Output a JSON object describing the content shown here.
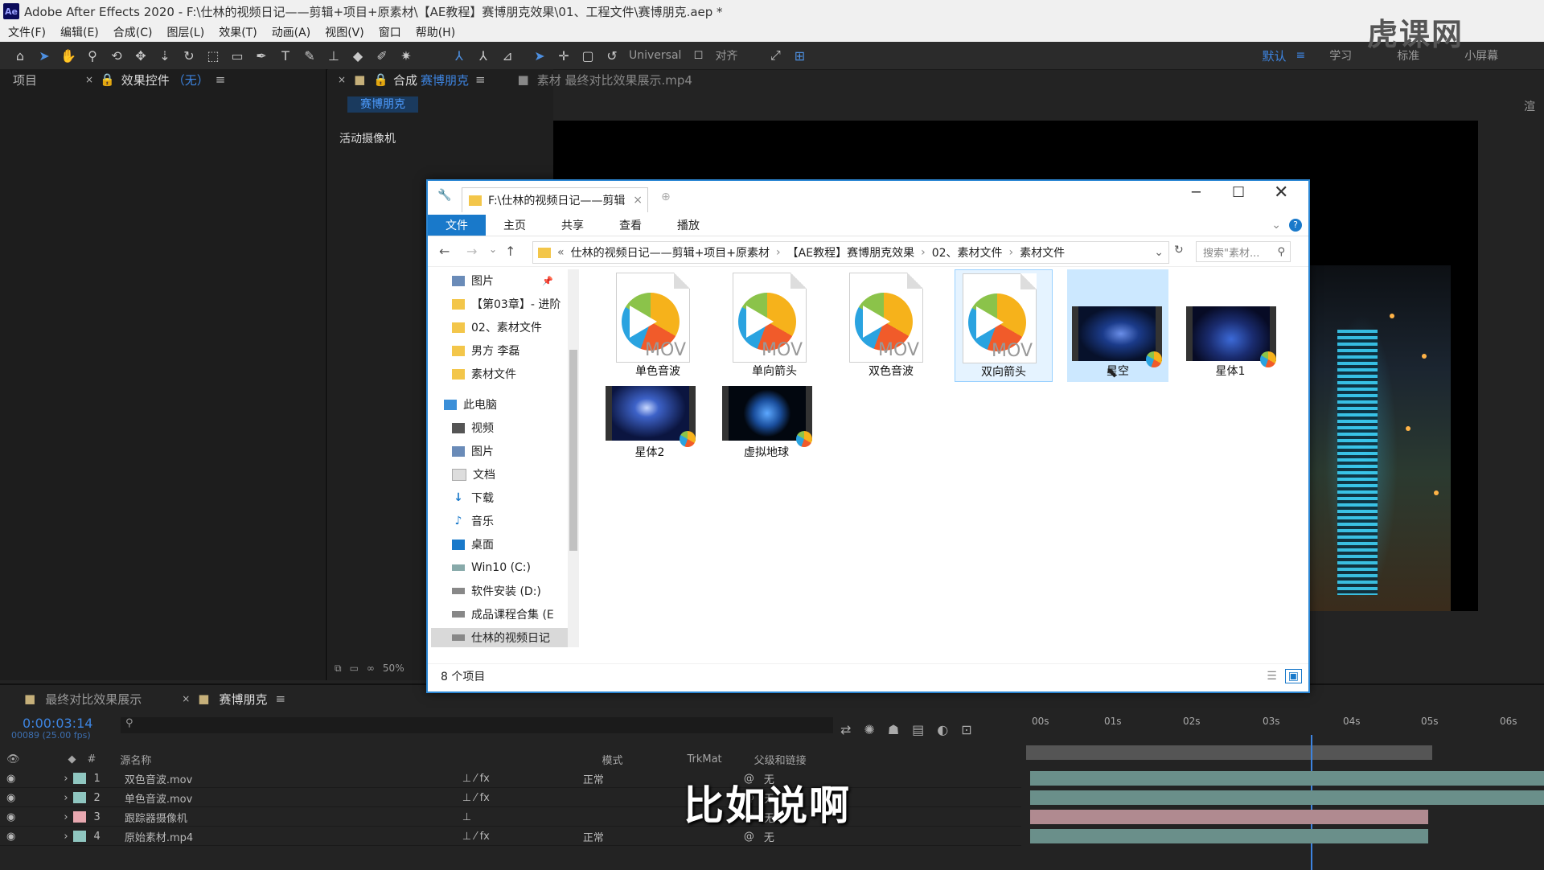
{
  "titlebar": {
    "app_icon": "Ae",
    "title": "Adobe After Effects 2020 - F:\\仕林的视频日记——剪辑+项目+原素材\\【AE教程】赛博朋克效果\\01、工程文件\\赛博朋克.aep *"
  },
  "menubar": [
    "文件(F)",
    "编辑(E)",
    "合成(C)",
    "图层(L)",
    "效果(T)",
    "动画(A)",
    "视图(V)",
    "窗口",
    "帮助(H)"
  ],
  "toolbar": {
    "axis_mode": "Universal",
    "snap_label": "对齐",
    "workspace": "默认",
    "workspace2": "学习",
    "workspace3": "标准",
    "workspace4": "小屏幕"
  },
  "watermark": "虎课网",
  "left_panel": {
    "tab_project": "项目",
    "tab_effects": "效果控件",
    "effects_target": "（无）"
  },
  "comp_panel": {
    "tab_comp": "合成",
    "comp_name": "赛博朋克",
    "tab_footage": "素材 最终对比效果展示.mp4",
    "active_comp_button": "赛博朋克",
    "camera_label": "活动摄像机",
    "zoom": "50%",
    "render_label": "渲"
  },
  "explorer": {
    "tab_path": "F:\\仕林的视频日记——剪辑",
    "ribbon": [
      "文件",
      "主页",
      "共享",
      "查看",
      "播放"
    ],
    "breadcrumb": [
      "仕林的视频日记——剪辑+项目+原素材",
      "【AE教程】赛博朋克效果",
      "02、素材文件",
      "素材文件"
    ],
    "search_placeholder": "搜索\"素材...",
    "nav": [
      {
        "label": "图片",
        "type": "pic"
      },
      {
        "label": "【第03章】- 进阶",
        "type": "folder"
      },
      {
        "label": "02、素材文件",
        "type": "folder"
      },
      {
        "label": "男方 李磊",
        "type": "folder"
      },
      {
        "label": "素材文件",
        "type": "folder"
      },
      {
        "label": "此电脑",
        "type": "pc"
      },
      {
        "label": "视频",
        "type": "video"
      },
      {
        "label": "图片",
        "type": "pic"
      },
      {
        "label": "文档",
        "type": "doc"
      },
      {
        "label": "下载",
        "type": "download"
      },
      {
        "label": "音乐",
        "type": "music"
      },
      {
        "label": "桌面",
        "type": "desktop"
      },
      {
        "label": "Win10 (C:)",
        "type": "drive"
      },
      {
        "label": "软件安装 (D:)",
        "type": "drive"
      },
      {
        "label": "成品课程合集 (E",
        "type": "drive"
      },
      {
        "label": "仕林的视频日记",
        "type": "drive"
      }
    ],
    "files": [
      {
        "name": "单色音波",
        "kind": "mov",
        "ext": "MOV"
      },
      {
        "name": "单向箭头",
        "kind": "mov",
        "ext": "MOV"
      },
      {
        "name": "双色音波",
        "kind": "mov",
        "ext": "MOV"
      },
      {
        "name": "双向箭头",
        "kind": "mov",
        "ext": "MOV"
      },
      {
        "name": "星空",
        "kind": "video"
      },
      {
        "name": "星体1",
        "kind": "video"
      },
      {
        "name": "星体2",
        "kind": "video"
      },
      {
        "name": "虚拟地球",
        "kind": "video"
      }
    ],
    "status": "8 个项目"
  },
  "timeline": {
    "tab1": "最终对比效果展示",
    "tab2": "赛博朋克",
    "timecode": "0:00:03:14",
    "frame_info": "00089 (25.00 fps)",
    "col_source": "源名称",
    "col_mode": "模式",
    "col_trkmat": "TrkMat",
    "col_parent": "父级和链接",
    "ruler": [
      "00s",
      "01s",
      "02s",
      "03s",
      "04s",
      "05s",
      "06s"
    ],
    "layers": [
      {
        "num": "1",
        "name": "双色音波.mov",
        "mode": "正常",
        "parent": "无",
        "color": "#8fc6c0"
      },
      {
        "num": "2",
        "name": "单色音波.mov",
        "mode": "",
        "parent": "无",
        "color": "#8fc6c0"
      },
      {
        "num": "3",
        "name": "跟踪器摄像机",
        "mode": "",
        "parent": "无",
        "color": "#e8a8b0"
      },
      {
        "num": "4",
        "name": "原始素材.mp4",
        "mode": "正常",
        "parent": "无",
        "color": "#8fc6c0"
      }
    ]
  },
  "subtitle": "比如说啊"
}
